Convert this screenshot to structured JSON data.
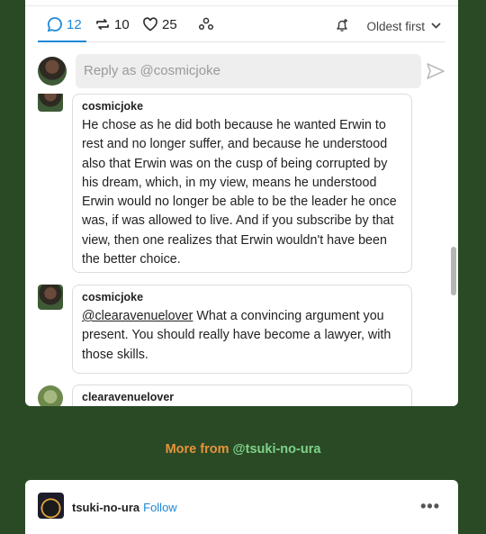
{
  "actions": {
    "replies": "12",
    "reblogs": "10",
    "likes": "25",
    "sort": "Oldest first"
  },
  "reply": {
    "placeholder": "Reply as @cosmicjoke"
  },
  "comments": [
    {
      "user": "cosmicjoke",
      "text": "He chose as he did both because he wanted Erwin to rest and no longer suffer, and because he understood also that Erwin was on the cusp of being corrupted by his dream, which, in my view, means he understood Erwin would no longer be able to be the leader he once was, if was allowed to live.  And if you subscribe by that view, then one realizes that Erwin wouldn't have been the better choice."
    },
    {
      "user": "cosmicjoke",
      "mention": "@clearavenuelover",
      "text": " What a convincing argument you present.  You should really have become a lawyer, with those skills."
    },
    {
      "user": "clearavenuelover",
      "text": ""
    }
  ],
  "more_from": {
    "prefix": "More from ",
    "handle": "@tsuki-no-ura"
  },
  "post": {
    "author": "tsuki-no-ura",
    "follow": "Follow",
    "menu": "•••"
  },
  "colors": {
    "accent": "#1e88d8",
    "page_bg": "#2a4a26",
    "more_orange": "#e8933a",
    "more_green": "#7fd18a"
  }
}
